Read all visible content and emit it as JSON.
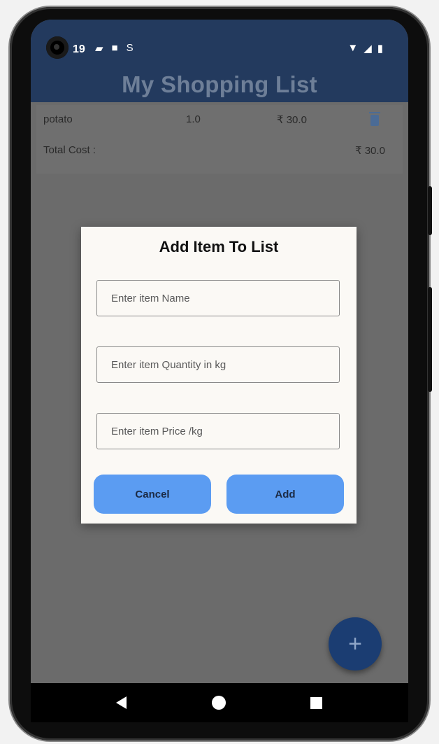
{
  "status_bar": {
    "time": "19",
    "left_icons": [
      "message-icon",
      "lock-icon",
      "s-icon"
    ],
    "right_icons": [
      "wifi-icon",
      "signal-icon",
      "battery-icon"
    ]
  },
  "appbar": {
    "title": "My Shopping List"
  },
  "list": {
    "items": [
      {
        "name": "potato",
        "quantity": "1.0",
        "price": "₹ 30.0"
      }
    ],
    "total_label": "Total Cost :",
    "total_value": "₹ 30.0"
  },
  "dialog": {
    "title": "Add Item To List",
    "name_placeholder": "Enter item Name",
    "quantity_placeholder": "Enter item Quantity in kg",
    "price_placeholder": "Enter item Price /kg",
    "cancel_label": "Cancel",
    "add_label": "Add"
  },
  "fab": {
    "label": "+"
  },
  "colors": {
    "appbar": "#233a5e",
    "accent_button": "#5b9cf2",
    "fab": "#1b3d72"
  }
}
